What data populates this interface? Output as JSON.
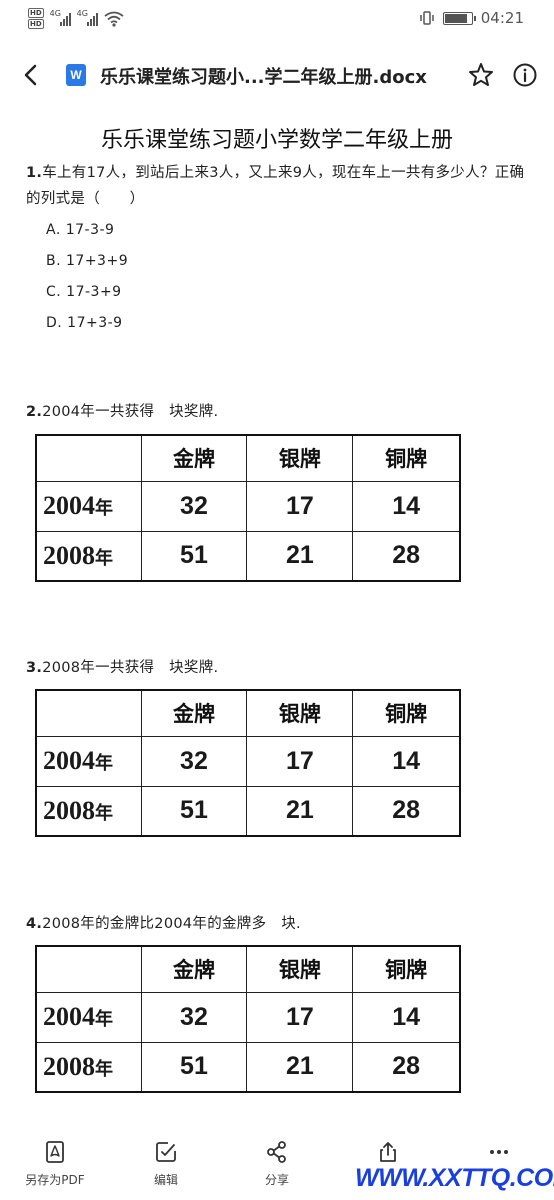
{
  "status_bar": {
    "hd1": "HD",
    "hd2": "HD",
    "net1": "4G",
    "net2": "4G",
    "time": "04:21"
  },
  "title_bar": {
    "doc_icon_letter": "W",
    "title": "乐乐课堂练习题小...学二年级上册.docx"
  },
  "document": {
    "heading": "乐乐课堂练习题小学数学二年级上册",
    "q1": {
      "num": "1.",
      "text": "车上有17人，到站后上来3人，又上来9人，现在车上一共有多少人？正确的列式是（　　）",
      "options": [
        "A. 17-3-9",
        "B. 17+3+9",
        "C. 17-3+9",
        "D. 17+3-9"
      ]
    },
    "q2": {
      "num": "2.",
      "text": "2004年一共获得　块奖牌."
    },
    "q3": {
      "num": "3.",
      "text": "2008年一共获得　块奖牌."
    },
    "q4": {
      "num": "4.",
      "text": "2008年的金牌比2004年的金牌多　块."
    },
    "table": {
      "headers": [
        "金牌",
        "银牌",
        "铜牌"
      ],
      "rows": [
        {
          "year": "2004",
          "nian": "年",
          "values": [
            "32",
            "17",
            "14"
          ]
        },
        {
          "year": "2008",
          "nian": "年",
          "values": [
            "51",
            "21",
            "28"
          ]
        }
      ]
    }
  },
  "toolbar": {
    "items": [
      {
        "label": "另存为PDF",
        "icon": "pdf-icon"
      },
      {
        "label": "编辑",
        "icon": "edit-icon"
      },
      {
        "label": "分享",
        "icon": "share-icon"
      },
      {
        "label": "",
        "icon": "export-icon"
      },
      {
        "label": "",
        "icon": "more-icon"
      }
    ]
  },
  "watermark": "WWW.XXTTQ.COM"
}
